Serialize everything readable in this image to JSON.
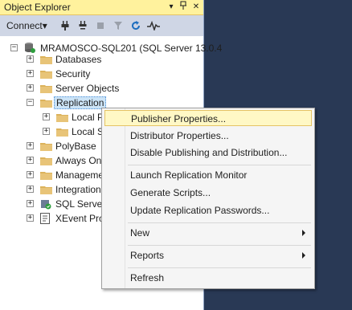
{
  "panel": {
    "title": "Object Explorer",
    "pin_glyph": "↓",
    "close_glyph": "✕"
  },
  "toolbar": {
    "connect_label": "Connect",
    "connect_arrow": "▾"
  },
  "tree": {
    "server": "MRAMOSCO-SQL201 (SQL Server 13.0.4",
    "items": [
      {
        "label": "Databases"
      },
      {
        "label": "Security"
      },
      {
        "label": "Server Objects"
      },
      {
        "label": "Replication"
      },
      {
        "label": "Local P"
      },
      {
        "label": "Local S"
      },
      {
        "label": "PolyBase"
      },
      {
        "label": "Always On"
      },
      {
        "label": "Manageme"
      },
      {
        "label": "Integration"
      },
      {
        "label": "SQL Server"
      },
      {
        "label": "XEvent Pro"
      }
    ]
  },
  "context_menu": {
    "items": [
      {
        "label": "Publisher Properties..."
      },
      {
        "label": "Distributor Properties..."
      },
      {
        "label": "Disable Publishing and Distribution..."
      },
      {
        "label": "Launch Replication Monitor"
      },
      {
        "label": "Generate Scripts..."
      },
      {
        "label": "Update Replication Passwords..."
      },
      {
        "label": "New"
      },
      {
        "label": "Reports"
      },
      {
        "label": "Refresh"
      }
    ]
  },
  "colors": {
    "background": "#293955",
    "title_bar": "#fff29d",
    "toolbar": "#cfd6e5",
    "menu_highlight": "#fff8c5",
    "folder": "#dcb35c"
  },
  "icons": [
    "pin-icon",
    "close-icon",
    "connect-icon",
    "disconnect-icon",
    "stop-icon",
    "filter-icon",
    "refresh-icon",
    "activity-monitor-icon",
    "server-icon",
    "folder-icon",
    "sql-agent-icon",
    "xevent-icon",
    "submenu-arrow-icon"
  ]
}
